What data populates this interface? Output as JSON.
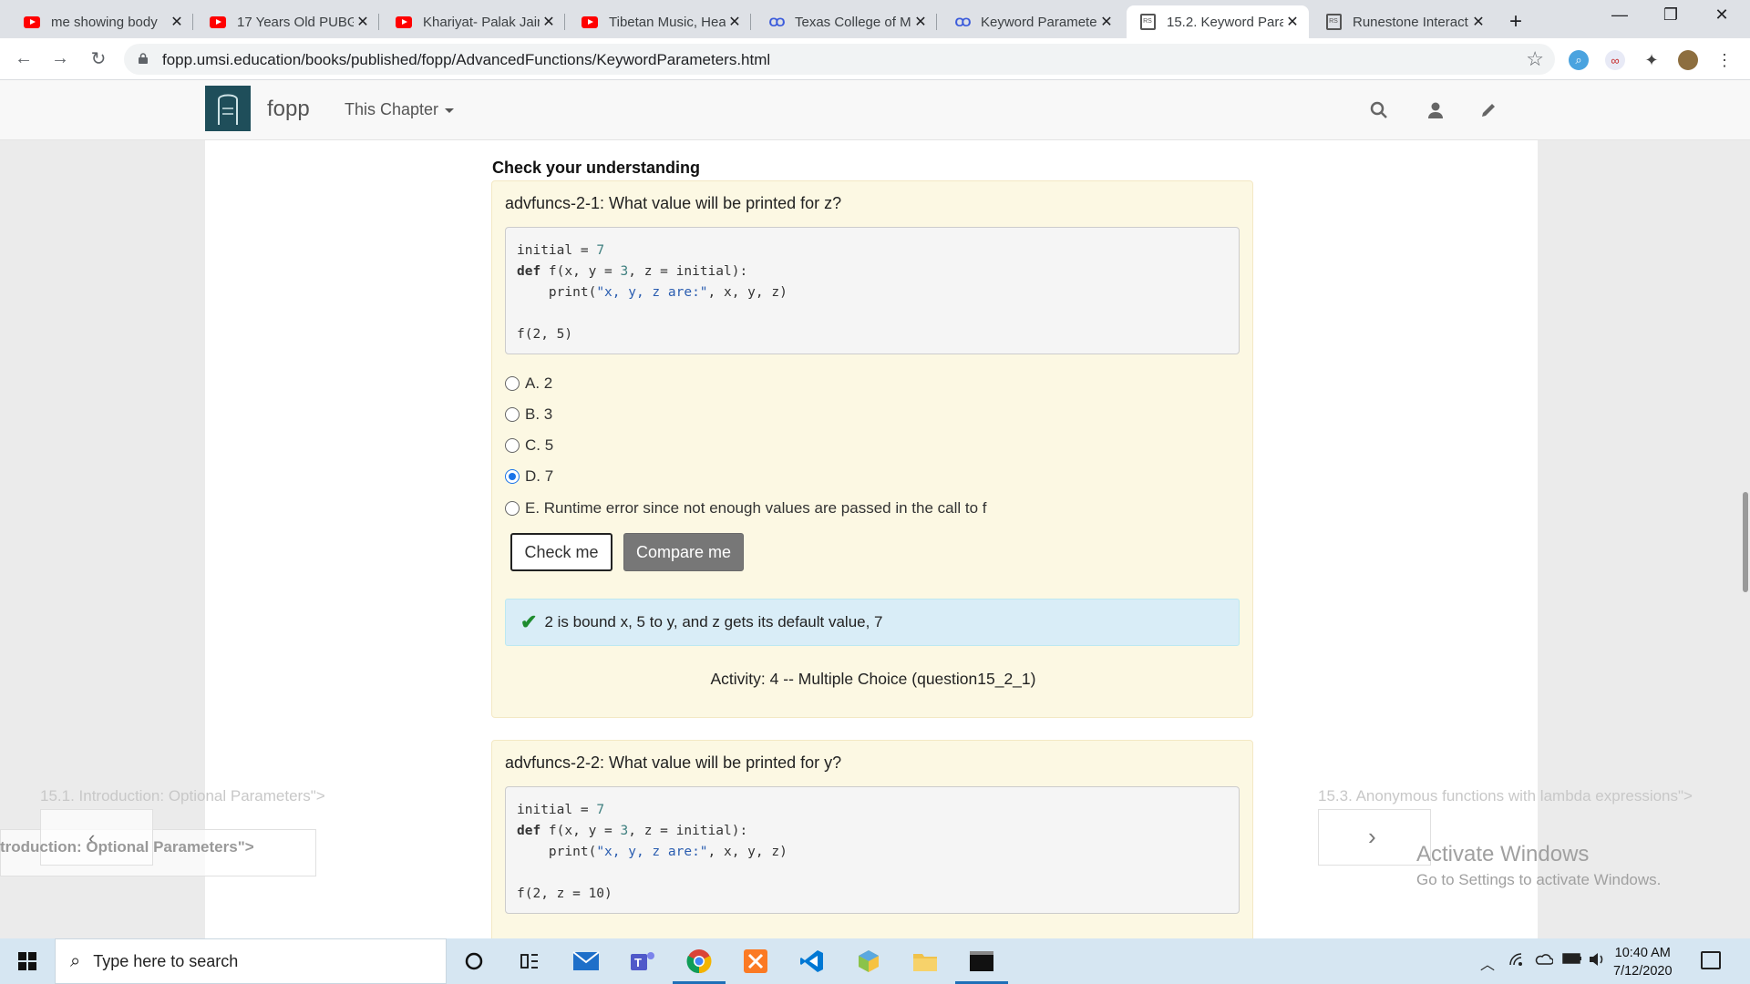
{
  "browser": {
    "tabs": [
      {
        "title": "me showing body",
        "icon": "youtube-icon"
      },
      {
        "title": "17 Years Old PUBG",
        "icon": "youtube-icon"
      },
      {
        "title": "Khariyat- Palak Jain",
        "icon": "youtube-icon"
      },
      {
        "title": "Tibetan Music, Hea",
        "icon": "youtube-icon"
      },
      {
        "title": "Texas College of M",
        "icon": "coursera-icon"
      },
      {
        "title": "Keyword Paramete",
        "icon": "coursera-icon"
      },
      {
        "title": "15.2. Keyword Para",
        "icon": "runestone-icon",
        "active": true
      },
      {
        "title": "Runestone Interact",
        "icon": "runestone-icon"
      }
    ],
    "url": "fopp.umsi.education/books/published/fopp/AdvancedFunctions/KeywordParameters.html"
  },
  "site": {
    "brand": "fopp",
    "chapter_menu": "This Chapter"
  },
  "section_title": "Check your understanding",
  "questions": [
    {
      "prompt": "advfuncs-2-1: What value will be printed for z?",
      "code_call": "f(2, 5)",
      "options": [
        {
          "label": "A. 2",
          "selected": false
        },
        {
          "label": "B. 3",
          "selected": false
        },
        {
          "label": "C. 5",
          "selected": false
        },
        {
          "label": "D. 7",
          "selected": true
        },
        {
          "label": "E. Runtime error since not enough values are passed in the call to f",
          "selected": false
        }
      ],
      "check_label": "Check me",
      "compare_label": "Compare me",
      "feedback": "2 is bound x, 5 to y, and z gets its default value, 7",
      "activity": "Activity: 4 -- Multiple Choice (question15_2_1)"
    },
    {
      "prompt": "advfuncs-2-2: What value will be printed for y?",
      "code_call": "f(2, z = 10)"
    }
  ],
  "nav": {
    "prev_link": "15.1. Introduction: Optional Parameters\">",
    "prev_button_text": "troduction: Optional Parameters\">",
    "next_link": "15.3. Anonymous functions with lambda expressions\">"
  },
  "watermark": {
    "line1": "Activate Windows",
    "line2": "Go to Settings to activate Windows."
  },
  "taskbar": {
    "search_placeholder": "Type here to search",
    "time": "10:40 AM",
    "date": "7/12/2020"
  },
  "colors": {
    "question_bg": "#fcf8e3",
    "feedback_bg": "#d9edf7",
    "accent": "#1a73e8"
  }
}
